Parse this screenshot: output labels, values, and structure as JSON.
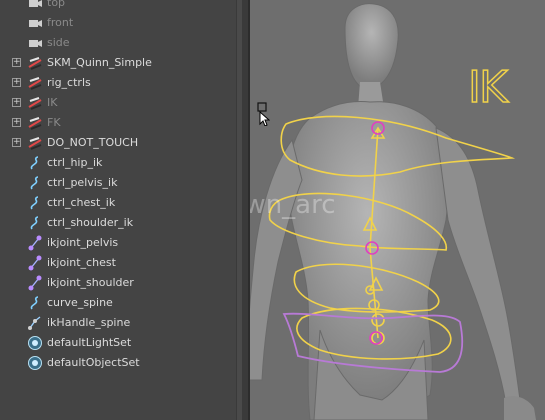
{
  "outliner": {
    "items": [
      {
        "label": "top",
        "icon": "camera-icon",
        "expandable": false,
        "dim": true
      },
      {
        "label": "front",
        "icon": "camera-icon",
        "expandable": false,
        "dim": true
      },
      {
        "label": "side",
        "icon": "camera-icon",
        "expandable": false,
        "dim": true
      },
      {
        "label": "SKM_Quinn_Simple",
        "icon": "transform-group-icon",
        "expandable": true,
        "dim": false
      },
      {
        "label": "rig_ctrls",
        "icon": "transform-group-icon",
        "expandable": true,
        "dim": false
      },
      {
        "label": "IK",
        "icon": "transform-group-icon",
        "expandable": true,
        "dim": true
      },
      {
        "label": "FK",
        "icon": "transform-group-icon",
        "expandable": true,
        "dim": true
      },
      {
        "label": "DO_NOT_TOUCH",
        "icon": "transform-group-icon",
        "expandable": true,
        "dim": false
      },
      {
        "label": "ctrl_hip_ik",
        "icon": "nurbs-curve-icon",
        "expandable": false,
        "dim": false
      },
      {
        "label": "ctrl_pelvis_ik",
        "icon": "nurbs-curve-icon",
        "expandable": false,
        "dim": false
      },
      {
        "label": "ctrl_chest_ik",
        "icon": "nurbs-curve-icon",
        "expandable": false,
        "dim": false
      },
      {
        "label": "ctrl_shoulder_ik",
        "icon": "nurbs-curve-icon",
        "expandable": false,
        "dim": false
      },
      {
        "label": "ikjoint_pelvis",
        "icon": "joint-icon",
        "expandable": false,
        "dim": false
      },
      {
        "label": "ikjoint_chest",
        "icon": "joint-icon",
        "expandable": false,
        "dim": false
      },
      {
        "label": "ikjoint_shoulder",
        "icon": "joint-icon",
        "expandable": false,
        "dim": false
      },
      {
        "label": "curve_spine",
        "icon": "nurbs-curve-icon",
        "expandable": false,
        "dim": false
      },
      {
        "label": "ikHandle_spine",
        "icon": "ik-handle-icon",
        "expandable": false,
        "dim": false
      },
      {
        "label": "defaultLightSet",
        "icon": "set-icon",
        "expandable": false,
        "dim": false
      },
      {
        "label": "defaultObjectSet",
        "icon": "set-icon",
        "expandable": false,
        "dim": false
      }
    ]
  },
  "viewport": {
    "ik_label": "IK",
    "watermark": "@dawn_arc",
    "colors": {
      "background": "#6e6e6e",
      "mesh": "#9a9a9a",
      "ik_controls": "#f1d24a",
      "hip_control": "#b87ad6",
      "joint_highlight": "#e040c0"
    }
  }
}
